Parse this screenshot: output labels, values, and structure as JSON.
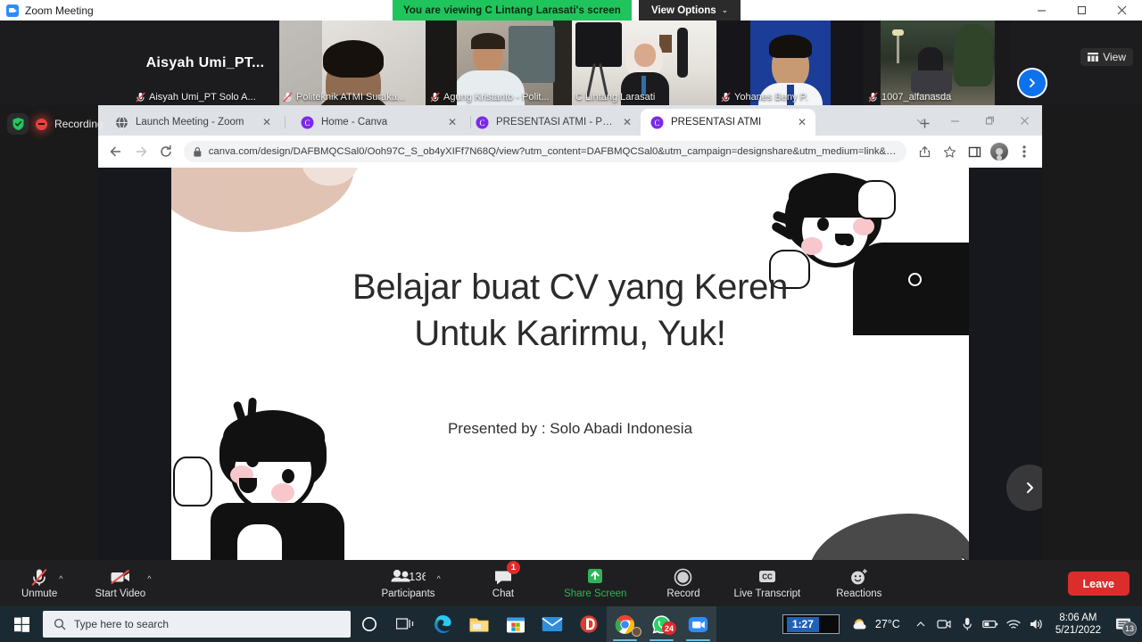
{
  "zoom_window": {
    "title": "Zoom Meeting",
    "logo_icon": "zoom-logo-icon",
    "share_banner": "You are viewing C Lintang Larasati's screen",
    "view_options_label": "View Options",
    "view_options_caret": "⌄",
    "minimize_icon": "minimize-icon",
    "maximize_icon": "maximize-icon",
    "close_icon": "close-icon",
    "view_button_label": "View",
    "view_button_icon": "grid-view-icon",
    "next_page_icon": "chevron-right-icon",
    "recording_label": "Recording",
    "shield_icon": "green-shield-icon",
    "recording_icon": "recording-dot-icon"
  },
  "participants_strip": [
    {
      "name": "Aisyah Umi_PT Solo A...",
      "big_name": "Aisyah  Umi_PT...",
      "muted": true,
      "video_off": true,
      "selected": false
    },
    {
      "name": "Politeknik ATMI Suraka...",
      "muted": true,
      "video_off": false,
      "selected": false
    },
    {
      "name": "Agung Kristanto - Polit...",
      "muted": true,
      "video_off": false,
      "selected": false
    },
    {
      "name": "C Lintang Larasati",
      "muted": false,
      "video_off": false,
      "selected": true
    },
    {
      "name": "Yohanes Beny P.",
      "muted": true,
      "video_off": false,
      "selected": false
    },
    {
      "name": "1007_alfanasda",
      "muted": true,
      "video_off": false,
      "selected": false
    }
  ],
  "browser": {
    "tabs": [
      {
        "title": "Launch Meeting - Zoom",
        "favicon": "zoom-globe-icon",
        "active": false,
        "close_icon": "✕"
      },
      {
        "title": "Home - Canva",
        "favicon": "canva-icon",
        "active": false,
        "close_icon": "✕"
      },
      {
        "title": "PRESENTASI ATMI - Presentation",
        "favicon": "canva-icon",
        "active": false,
        "close_icon": "✕"
      },
      {
        "title": "PRESENTASI ATMI",
        "favicon": "canva-icon",
        "active": true,
        "close_icon": "✕"
      }
    ],
    "new_tab_icon": "plus-icon",
    "tab_search_icon": "chevron-down-icon",
    "minimize_icon": "minimize-icon",
    "maximize_icon": "restore-icon",
    "close_icon": "close-icon",
    "back_icon": "back-arrow-icon",
    "forward_icon": "forward-arrow-icon",
    "reload_icon": "reload-icon",
    "lock_icon": "lock-icon",
    "url": "canva.com/design/DAFBMQCSal0/Ooh97C_S_ob4yXIFf7N68Q/view?utm_content=DAFBMQCSal0&utm_campaign=designshare&utm_medium=link&utm_...",
    "share_icon": "share-icon",
    "bookmark_icon": "star-icon",
    "sidepanel_icon": "side-panel-icon",
    "profile_icon": "profile-avatar-icon",
    "menu_icon": "three-dot-menu-icon"
  },
  "slide": {
    "title_line1": "Belajar buat CV yang Keren",
    "title_line2": "Untuk Karirmu, Yuk!",
    "subtitle": "Presented by : Solo Abadi Indonesia",
    "next_slide_icon": "chevron-right-icon",
    "illustration_top_right": "cartoon-girl-icon",
    "illustration_bottom_left": "cartoon-boy-icon",
    "brush_shape": "beige-brush-shape-icon",
    "rock_shape": "grey-rock-shape-icon"
  },
  "zoom_toolbar": {
    "items": [
      {
        "label": "Unmute",
        "icon": "microphone-muted-icon",
        "caret": "^"
      },
      {
        "label": "Start Video",
        "icon": "video-camera-off-icon",
        "caret": "^"
      },
      {
        "label": "Participants",
        "icon": "participants-icon",
        "count": "136",
        "caret": "^"
      },
      {
        "label": "Chat",
        "icon": "chat-bubble-icon",
        "badge": "1"
      },
      {
        "label": "Share Screen",
        "icon": "share-screen-icon"
      },
      {
        "label": "Record",
        "icon": "record-circle-icon"
      },
      {
        "label": "Live Transcript",
        "icon": "closed-caption-icon"
      },
      {
        "label": "Reactions",
        "icon": "reactions-smiley-icon"
      }
    ],
    "leave_label": "Leave",
    "share_screen_color": "#2fb457",
    "leave_color": "#dc2d2d"
  },
  "taskbar": {
    "start_icon": "windows-start-icon",
    "search_placeholder": "Type here to search",
    "search_icon": "search-icon",
    "cortana_icon": "cortana-circle-icon",
    "taskview_icon": "task-view-icon",
    "apps": [
      {
        "icon": "microsoft-edge-icon",
        "active": false
      },
      {
        "icon": "file-explorer-icon",
        "active": false
      },
      {
        "icon": "microsoft-store-icon",
        "active": false
      },
      {
        "icon": "mail-icon",
        "active": false
      },
      {
        "icon": "internet-download-manager-icon",
        "active": false
      },
      {
        "icon": "google-chrome-icon",
        "active": true,
        "badge": ""
      },
      {
        "icon": "whatsapp-icon",
        "active": true,
        "badge": "24"
      },
      {
        "icon": "zoom-app-icon",
        "active": true
      }
    ],
    "timer": "1:27",
    "weather_icon": "partly-sunny-icon",
    "weather_temp": "27°C",
    "tray_expand_icon": "chevron-up-icon",
    "tray_icons": [
      "webcam-icon",
      "microphone-tray-icon",
      "battery-tray-icon",
      "wifi-icon",
      "volume-icon"
    ],
    "time": "8:06 AM",
    "date": "5/21/2022",
    "notification_icon": "notification-icon",
    "notification_count": "13"
  }
}
